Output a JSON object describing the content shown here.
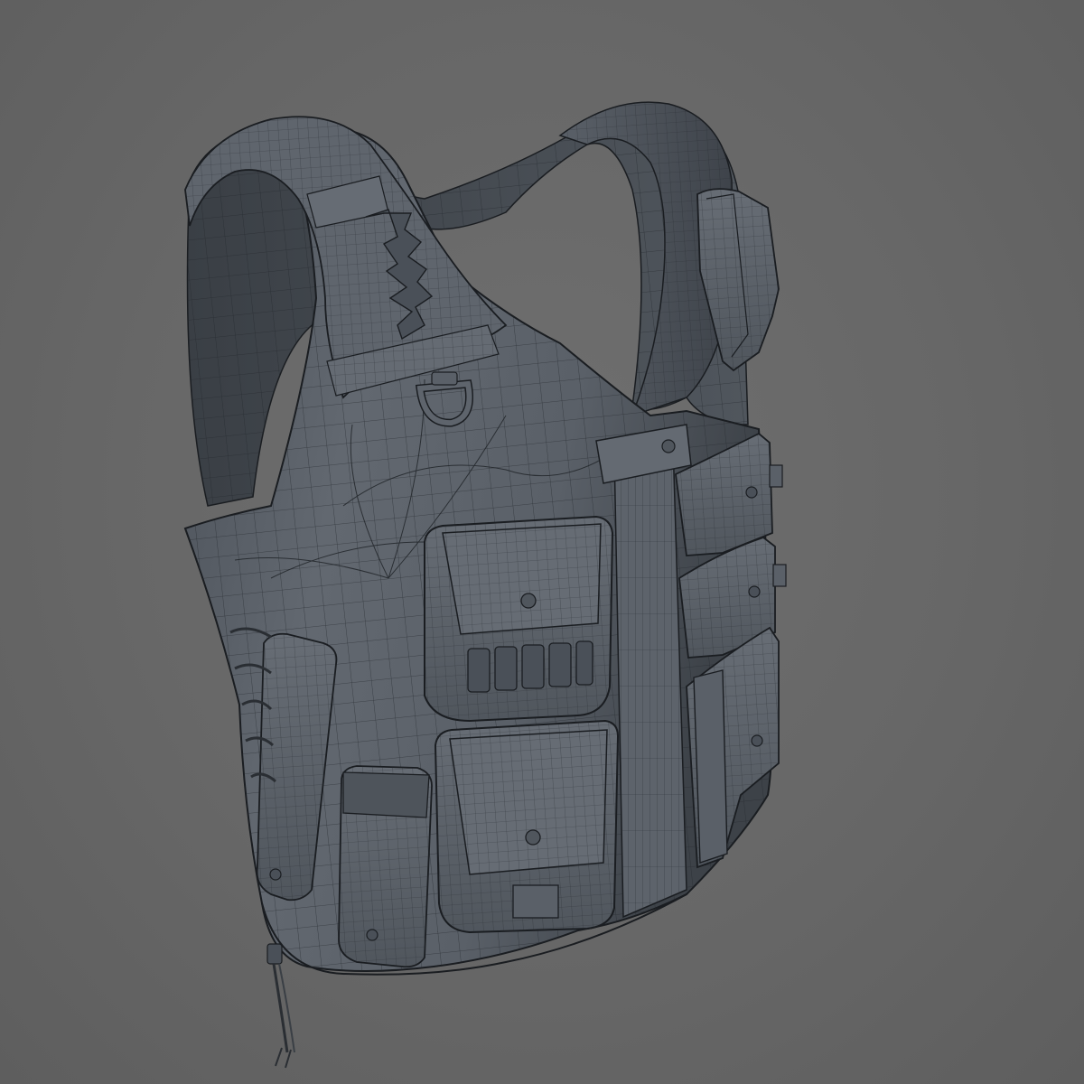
{
  "viewport": {
    "background": "#676767",
    "shading": "clay",
    "wireframe_overlay": true
  },
  "model": {
    "subject": "tactical-vest",
    "view": "three-quarter-front",
    "base_color": "#5b6169",
    "edge_color": "#1a1d21",
    "components": [
      "shoulder-strap-left",
      "shoulder-strap-right",
      "molle-loops",
      "d-ring",
      "chest-strap",
      "front-zipper-seam",
      "shotgun-shell-pouch",
      "large-utility-pouch",
      "flashlight-pouch",
      "magazine-pouch",
      "side-pouch-upper",
      "side-pouch-middle",
      "side-pouch-lower",
      "shoulder-radio-pouch",
      "drawstring-cord"
    ]
  }
}
